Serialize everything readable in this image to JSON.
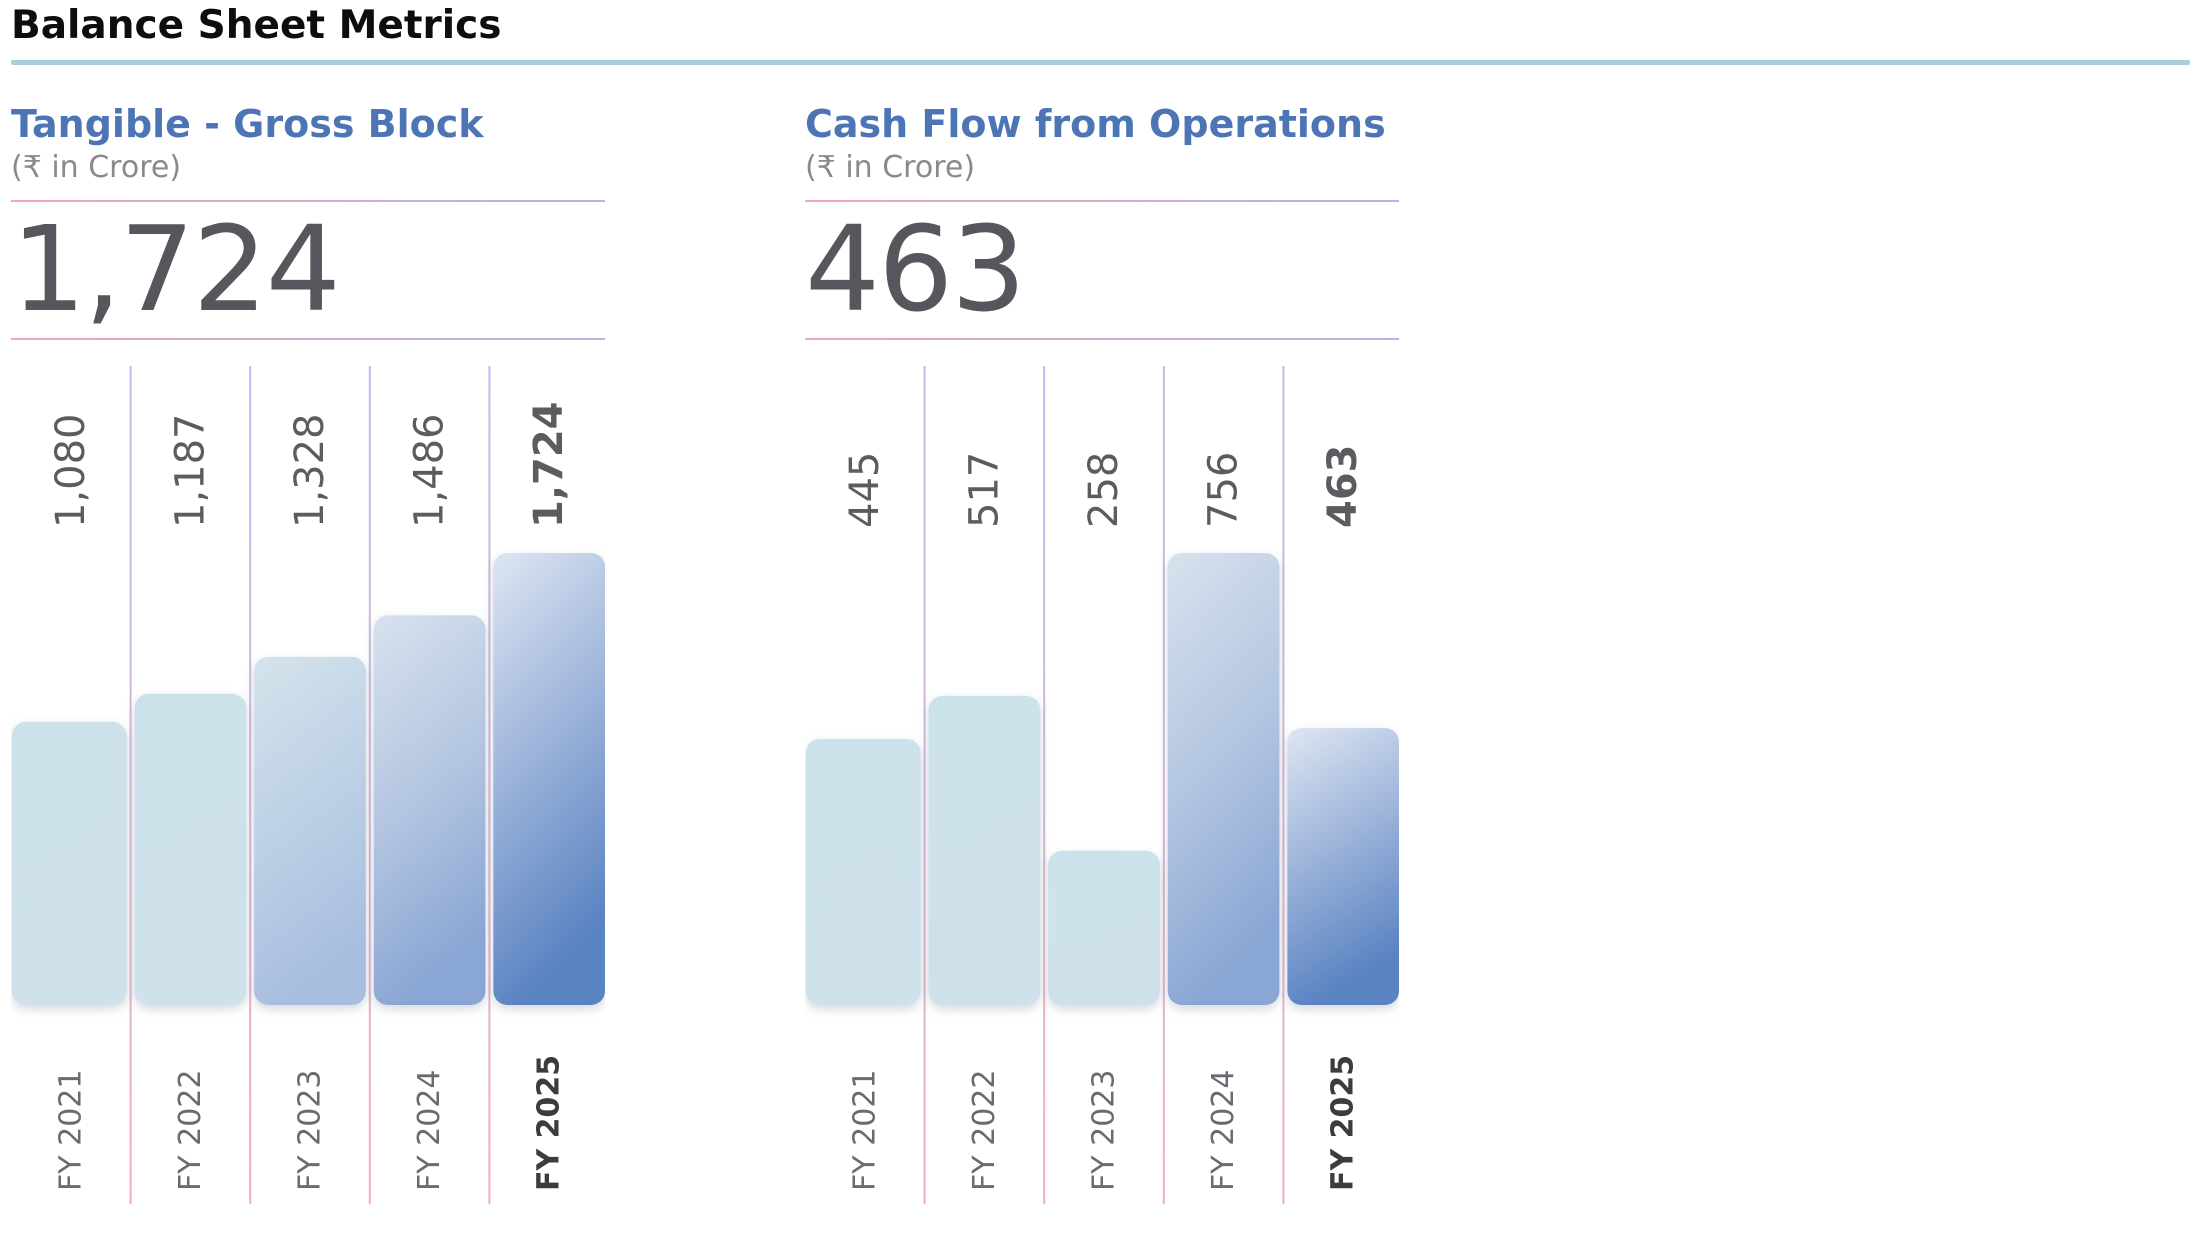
{
  "page": {
    "title": "Balance Sheet Metrics"
  },
  "panels": [
    {
      "title": "Tangible - Gross Block",
      "unit": "(₹ in Crore)",
      "headline": "1,724"
    },
    {
      "title": "Cash Flow from Operations",
      "unit": "(₹ in Crore)",
      "headline": "463"
    }
  ],
  "chart_data": [
    {
      "type": "bar",
      "title": "Tangible - Gross Block",
      "subtitle": "(₹ in Crore)",
      "categories": [
        "FY 2021",
        "FY 2022",
        "FY 2023",
        "FY 2024",
        "FY 2025"
      ],
      "values": [
        1080,
        1187,
        1328,
        1486,
        1724
      ],
      "value_labels": [
        "1,080",
        "1,187",
        "1,328",
        "1,486",
        "1,724"
      ],
      "highlight_index": 4,
      "grid": false,
      "colors": {
        "light": "#cce2ea",
        "dark": "#5a83c2"
      }
    },
    {
      "type": "bar",
      "title": "Cash Flow from Operations",
      "subtitle": "(₹ in Crore)",
      "categories": [
        "FY 2021",
        "FY 2022",
        "FY 2023",
        "FY 2024",
        "FY 2025"
      ],
      "values": [
        445,
        517,
        258,
        756,
        463
      ],
      "value_labels": [
        "445",
        "517",
        "258",
        "756",
        "463"
      ],
      "highlight_index": 4,
      "grid": false,
      "colors": {
        "light": "#cce2ea",
        "dark": "#5a83c2"
      }
    }
  ]
}
